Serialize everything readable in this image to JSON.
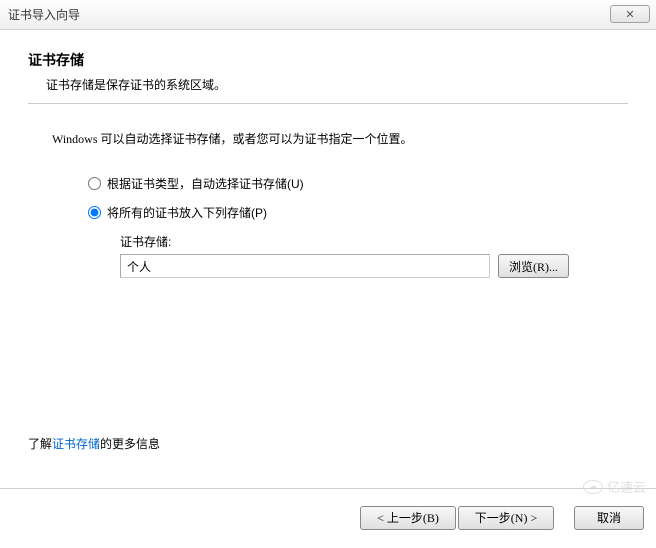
{
  "window": {
    "title": "证书导入向导",
    "close_glyph": "✕"
  },
  "page": {
    "heading": "证书存储",
    "subheading": "证书存储是保存证书的系统区域。",
    "instruction": "Windows 可以自动选择证书存储，或者您可以为证书指定一个位置。"
  },
  "radio": {
    "auto_label": "根据证书类型，自动选择证书存储(U)",
    "manual_label": "将所有的证书放入下列存储(P)"
  },
  "store": {
    "label": "证书存储:",
    "value": "个人",
    "browse_label": "浏览(R)..."
  },
  "learn": {
    "prefix": "了解",
    "link_text": "证书存储",
    "suffix": "的更多信息"
  },
  "footer": {
    "back_label": "< 上一步(B)",
    "next_label": "下一步(N) >",
    "cancel_label": "取消"
  },
  "watermark": {
    "text": "亿速云"
  }
}
